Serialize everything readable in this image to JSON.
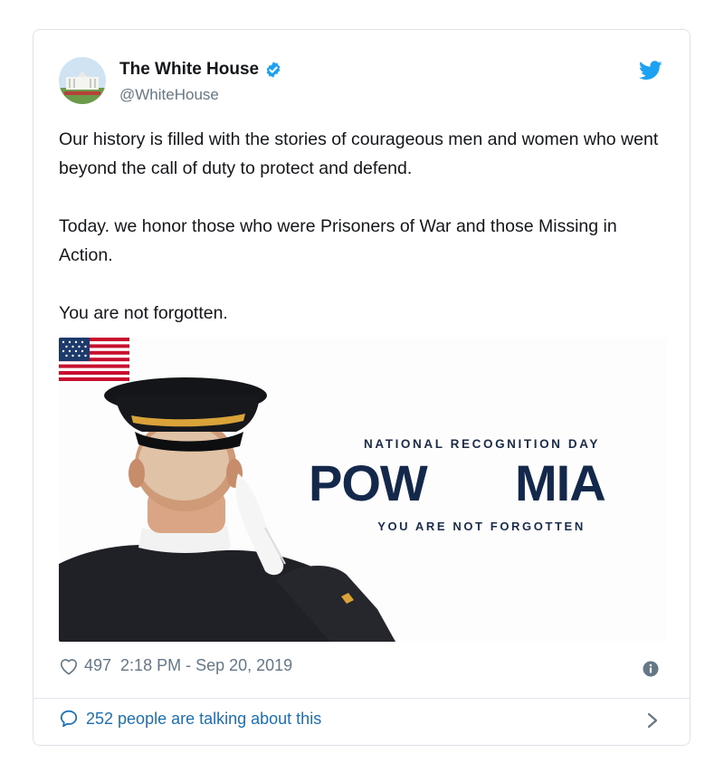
{
  "tweet": {
    "display_name": "The White House",
    "handle": "@WhiteHouse",
    "verified": true,
    "paragraphs": [
      "Our history is filled with the stories of courageous men and women who went beyond the call of duty to protect and defend.",
      "Today. we honor those who were Prisoners of War and those Missing in Action.",
      "You are not forgotten."
    ]
  },
  "media": {
    "kicker": "NATIONAL RECOGNITION DAY",
    "title_left": "POW",
    "title_right": "MIA",
    "tagline": "YOU ARE NOT FORGOTTEN",
    "colors": {
      "navy": "#14284b",
      "red": "#c8102e",
      "gold": "#d9a33a"
    }
  },
  "meta": {
    "likes": "497",
    "timestamp": "2:18 PM - Sep 20, 2019"
  },
  "footer": {
    "talking": "252 people are talking about this"
  },
  "icons": {
    "brand": "twitter-bird-icon",
    "verified": "verified-badge-icon",
    "like": "heart-icon",
    "info": "info-icon",
    "reply": "chat-bubble-icon",
    "chevron": "chevron-right-icon"
  },
  "colors": {
    "accent": "#1da1f2",
    "link": "#1b6fb3",
    "muted": "#657786",
    "border": "#dfe3e8"
  }
}
